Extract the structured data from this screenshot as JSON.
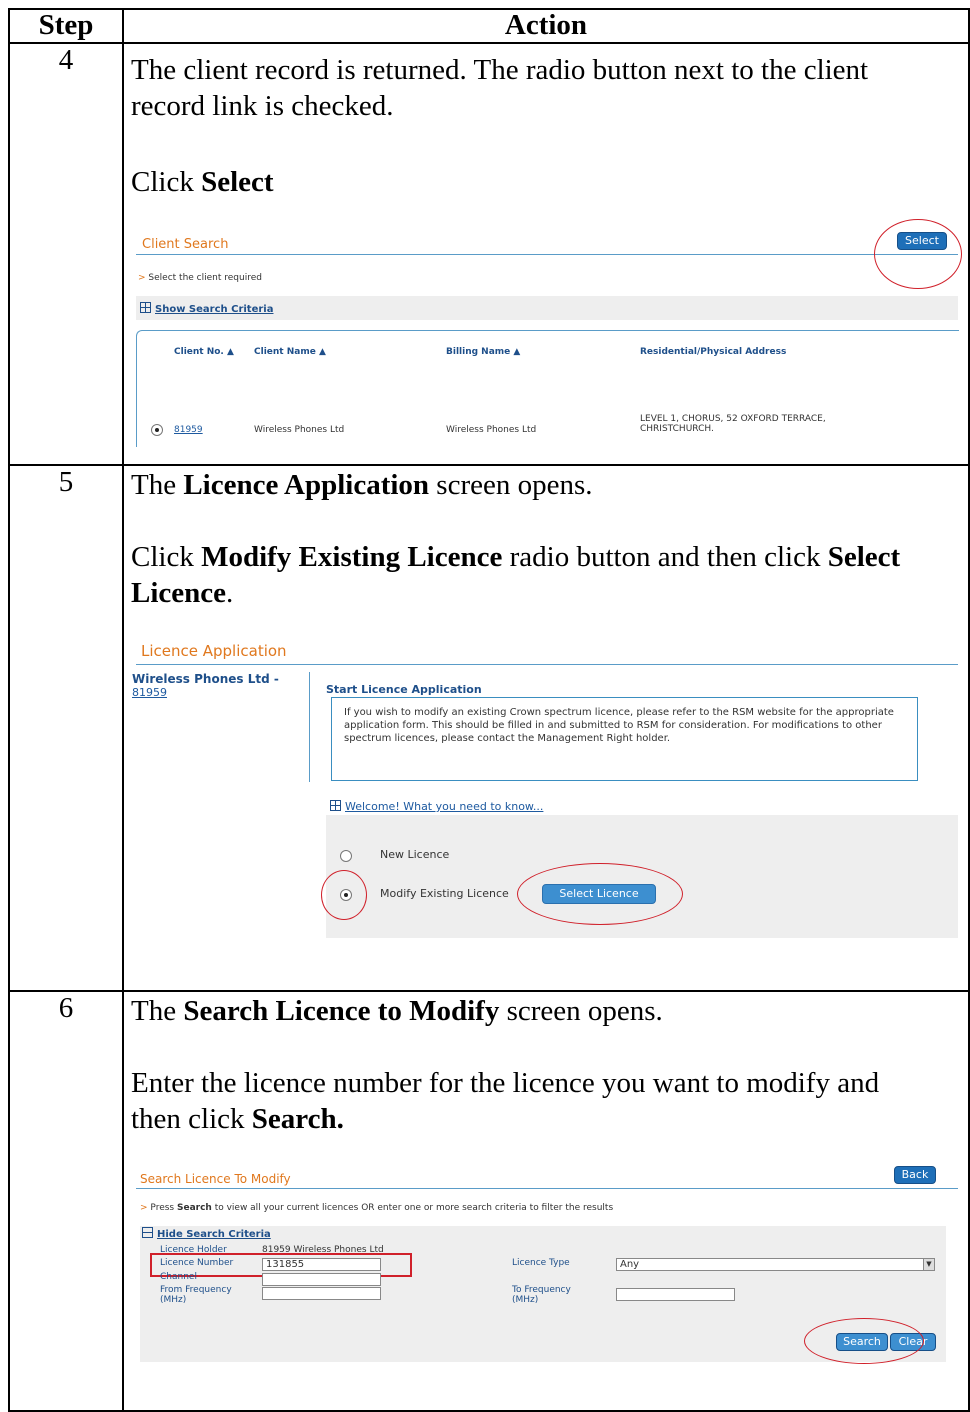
{
  "table": {
    "col_step": "Step",
    "col_action": "Action"
  },
  "step4": {
    "num": "4",
    "text1": "The client record is returned.  The radio button next to the client record link is checked.",
    "text2_pre": "Click ",
    "text2_bold": "Select",
    "shot": {
      "title": "Client Search",
      "select_btn": "Select",
      "instruction_arrow": ">",
      "instruction": "Select the client required",
      "toggle_link": "Show Search Criteria",
      "cols": [
        "Client No. ▲",
        "Client Name ▲",
        "Billing Name ▲",
        "Residential/Physical Address"
      ],
      "row": {
        "client_no": "81959",
        "client_name": "Wireless Phones Ltd",
        "billing_name": "Wireless Phones Ltd",
        "address_l1": "LEVEL 1, CHORUS, 52 OXFORD TERRACE,",
        "address_l2": "CHRISTCHURCH."
      }
    }
  },
  "step5": {
    "num": "5",
    "t1_pre": "The ",
    "t1_bold": "Licence Application",
    "t1_post": " screen opens.",
    "t2_pre": "Click ",
    "t2_bold1": "Modify Existing Licence",
    "t2_mid": " radio button and then click ",
    "t2_bold2": "Select Licence",
    "t2_post": ".",
    "shot": {
      "title": "Licence Application",
      "client_name": "Wireless Phones Ltd -",
      "client_no": "81959",
      "section_title": "Start Licence Application",
      "info": "If you wish to modify an existing Crown spectrum licence, please refer to the RSM website for the appropriate application form. This should be filled in and submitted to RSM for consideration. For modifications to other spectrum licences, please contact the Management Right holder.",
      "welcome_link": "Welcome! What you need to know...",
      "opt_new": "New Licence",
      "opt_modify": "Modify Existing Licence",
      "select_licence_btn": "Select Licence"
    }
  },
  "step6": {
    "num": "6",
    "t1_pre": "The ",
    "t1_bold": "Search Licence to Modify",
    "t1_post": " screen opens.",
    "t2_pre": "Enter the licence number for the licence you want to modify and then click ",
    "t2_bold": "Search.",
    "shot": {
      "title": "Search Licence To Modify",
      "back_btn": "Back",
      "instruction_arrow": ">",
      "instruction_pre": "Press ",
      "instruction_bold": "Search",
      "instruction_post": " to view all your current licences OR enter one or more search criteria to filter the results",
      "toggle_link": "Hide Search Criteria",
      "holder_label": "Licence Holder",
      "holder_value": "81959 Wireless Phones Ltd",
      "number_label": "Licence Number",
      "number_value": "131855",
      "channel_label": "Channel",
      "from_label_1": "From Frequency",
      "from_label_2": "(MHz)",
      "type_label": "Licence Type",
      "type_value": "Any",
      "to_label_1": "To Frequency",
      "to_label_2": "(MHz)",
      "search_btn": "Search",
      "clear_btn": "Clear"
    }
  },
  "colors": {
    "accent_orange": "#e0781e",
    "link_blue": "#1e5aa0",
    "button_blue": "#1e6fb8",
    "annotation_red": "#d0202a"
  }
}
